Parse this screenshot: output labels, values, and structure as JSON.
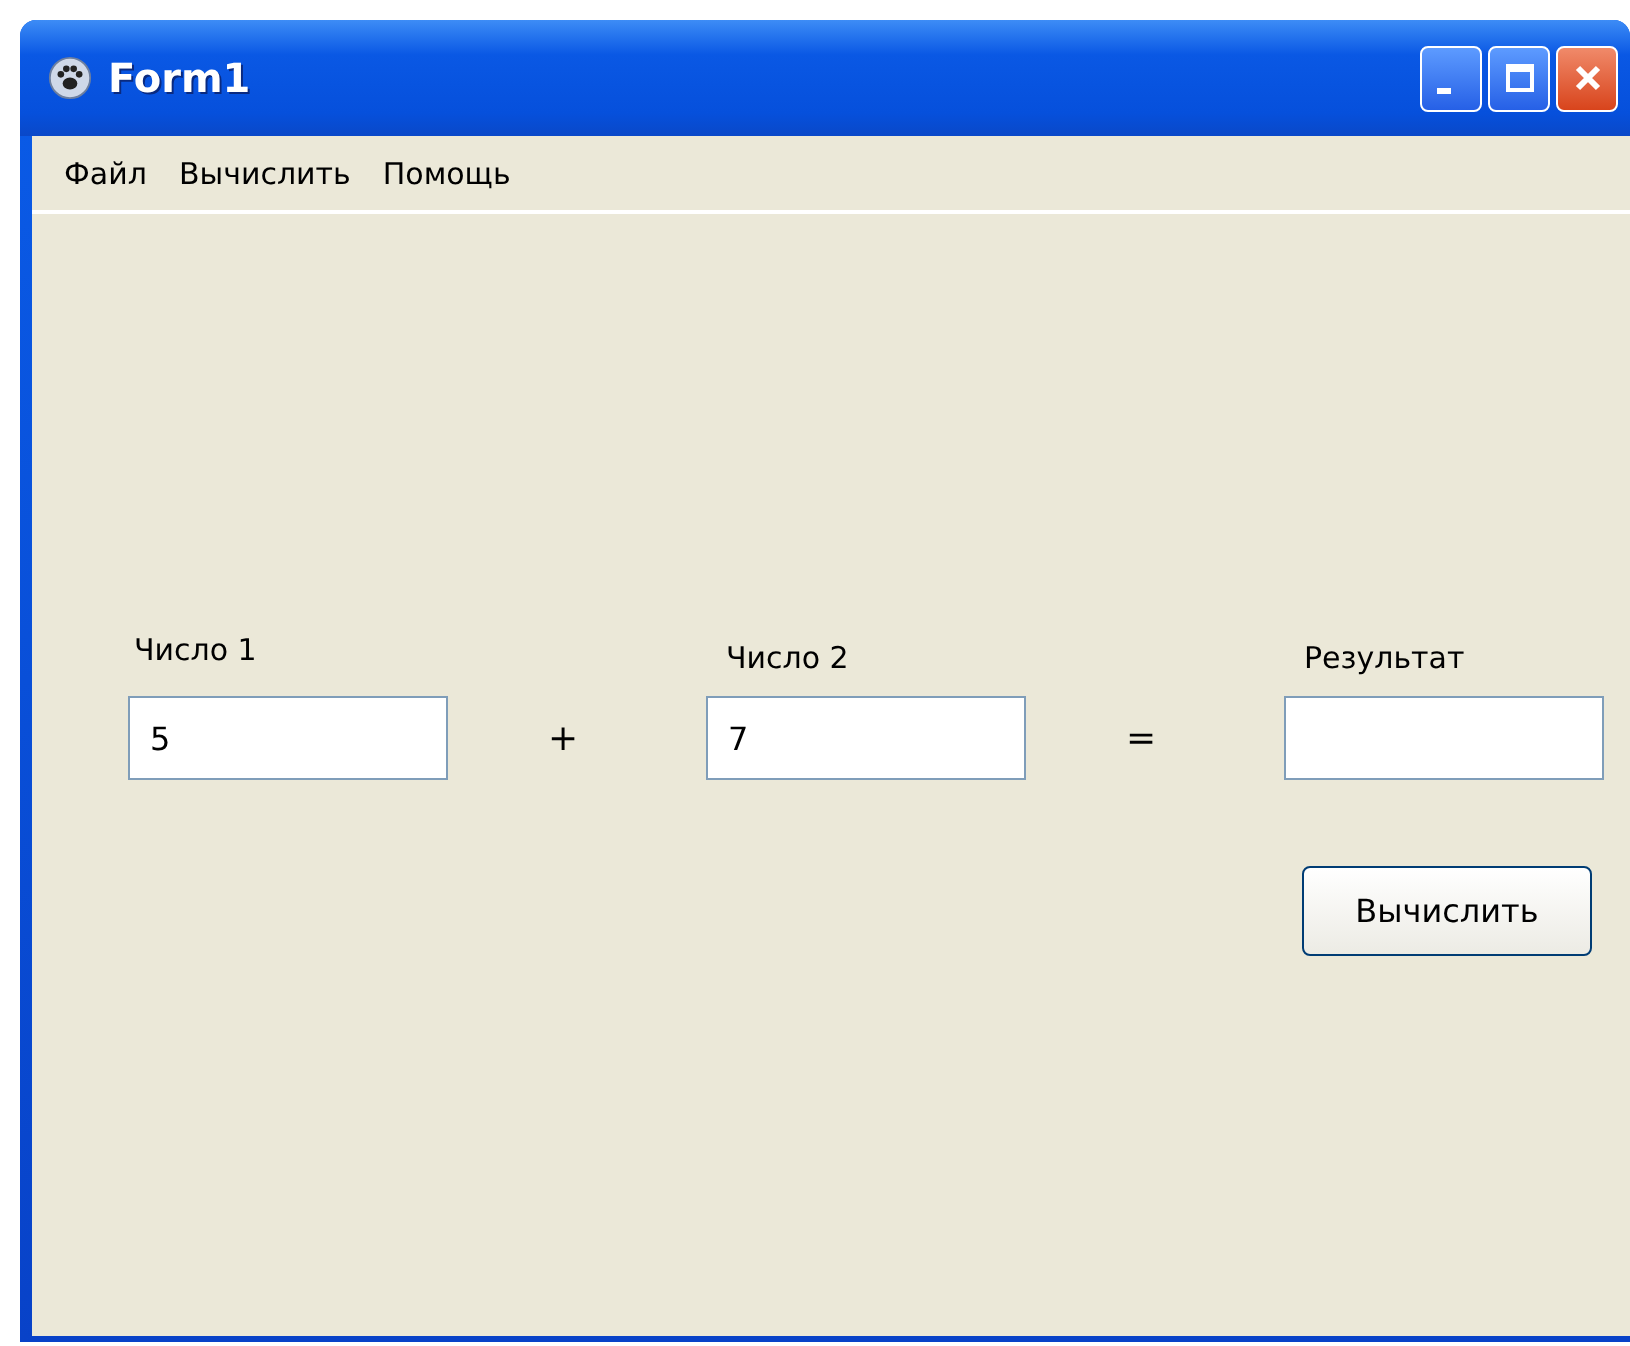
{
  "window": {
    "title": "Form1"
  },
  "menu": [
    "Файл",
    "Вычислить",
    "Помощь"
  ],
  "fields": [
    {
      "label": "Число 1",
      "value": "5"
    },
    {
      "label": "Число 2",
      "value": "7"
    },
    {
      "label": "Результат"
    }
  ],
  "operators": [
    "+",
    "="
  ],
  "button": "Вычислить"
}
